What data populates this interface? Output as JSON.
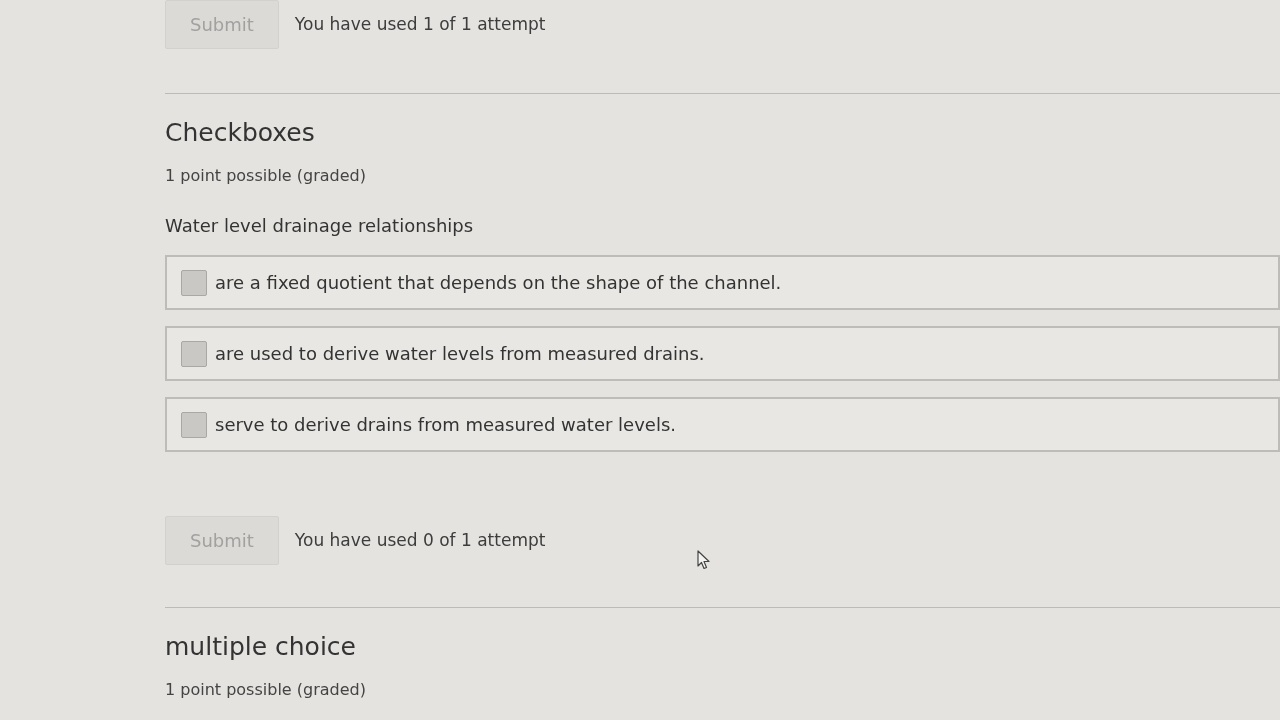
{
  "previous_problem": {
    "submit": {
      "label": "Submit",
      "disabled": true
    },
    "attempts": "You have used 1 of 1 attempt"
  },
  "problems": [
    {
      "title": "Checkboxes",
      "points": "1 point possible (graded)",
      "question": "Water level drainage relationships",
      "options": [
        {
          "label": "are a fixed quotient that depends on the shape of the channel.",
          "checked": false
        },
        {
          "label": "are used to derive water levels from measured drains.",
          "checked": false
        },
        {
          "label": "serve to derive drains from measured water levels.",
          "checked": false
        }
      ],
      "submit": {
        "label": "Submit",
        "disabled": true
      },
      "attempts": "You have used 0 of 1 attempt"
    },
    {
      "title": "multiple choice",
      "points": "1 point possible (graded)"
    }
  ]
}
